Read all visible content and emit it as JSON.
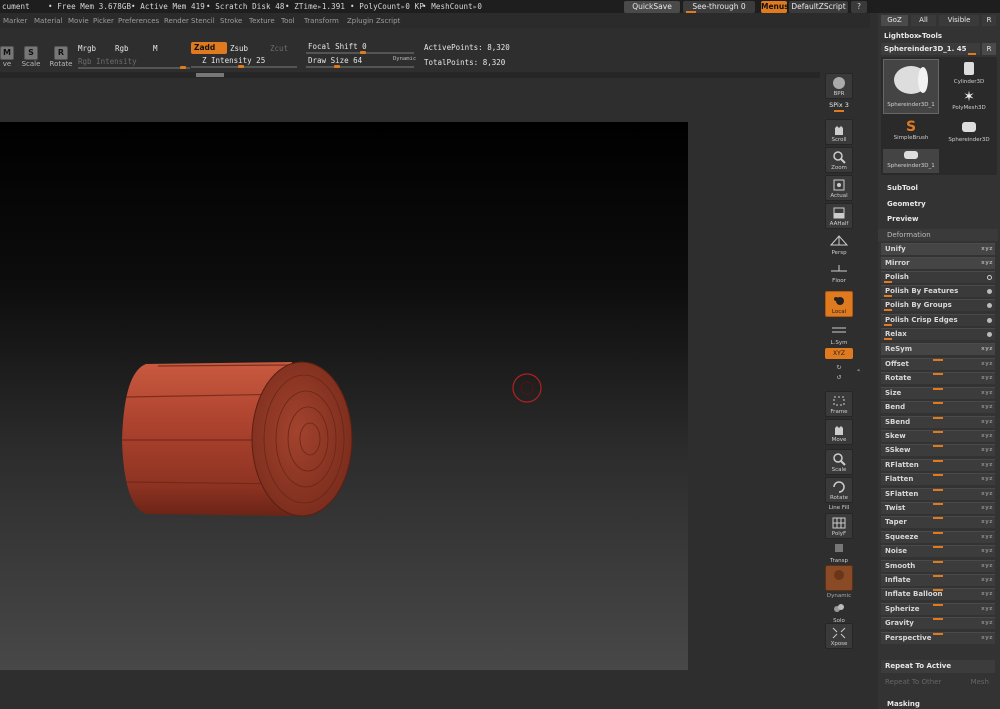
{
  "status": {
    "doc": "cument",
    "free_mem": "• Free Mem 3.678GB",
    "active_mem": "• Active Mem 419",
    "scratch": "• Scratch Disk 48",
    "ztime": "• ZTime▹1.391",
    "polycount": "• PolyCount▹0 KP",
    "meshcount": "• MeshCount▹0"
  },
  "top_buttons": {
    "quicksave": "QuickSave",
    "see_through": "See-through  0",
    "menus": "Menus",
    "default_zscript": "DefaultZScript"
  },
  "menus": [
    "Marker",
    "Material",
    "Movie",
    "Picker",
    "Preferences",
    "Render",
    "Stencil",
    "Stroke",
    "Texture",
    "Tool",
    "Transform",
    "Zplugin",
    "Zscript"
  ],
  "shelf": {
    "move_label": "ve",
    "scale_label": "Scale",
    "rotate_label": "Rotate",
    "mrgb": "Mrgb",
    "rgb": "Rgb",
    "m": "M",
    "rgb_intensity": "Rgb Intensity",
    "zadd": "Zadd",
    "zsub": "Zsub",
    "zcut": "Zcut",
    "z_intensity": "Z Intensity 25",
    "focal_shift": "Focal Shift 0",
    "draw_size": "Draw Size 64",
    "dynamic": "Dynamic",
    "active_points": "ActivePoints: 8,320",
    "total_points": "TotalPoints: 8,320",
    "levels": {
      "z_intensity": 25,
      "focal_shift": 0,
      "draw_size": 64
    }
  },
  "right_shelf": [
    {
      "name": "bpr",
      "label": "BPR"
    },
    {
      "name": "spix",
      "label": "SPix 3"
    },
    {
      "name": "scroll",
      "label": "Scroll"
    },
    {
      "name": "zoom",
      "label": "Zoom"
    },
    {
      "name": "actual",
      "label": "Actual"
    },
    {
      "name": "aahalf",
      "label": "AAHalf"
    },
    {
      "name": "persp",
      "label": "Persp"
    },
    {
      "name": "dynamic",
      "label": "Dynamic"
    },
    {
      "name": "floor",
      "label": "Floor"
    },
    {
      "name": "local",
      "label": "Local"
    },
    {
      "name": "lsym",
      "label": "L.Sym"
    },
    {
      "name": "xyz",
      "label": "XYZ"
    },
    {
      "name": "frame",
      "label": "Frame"
    },
    {
      "name": "move",
      "label": "Move"
    },
    {
      "name": "scale",
      "label": "Scale"
    },
    {
      "name": "rotate",
      "label": "Rotate"
    },
    {
      "name": "linefill",
      "label": "Line Fill"
    },
    {
      "name": "polyf",
      "label": "PolyF"
    },
    {
      "name": "transp",
      "label": "Transp"
    },
    {
      "name": "ghost",
      "label": ""
    },
    {
      "name": "dynamic2",
      "label": "Dynamic"
    },
    {
      "name": "solo",
      "label": "Solo"
    },
    {
      "name": "xpose",
      "label": "Xpose"
    }
  ],
  "panel": {
    "goz": "GoZ",
    "all": "All",
    "visible": "Visible",
    "r": "R",
    "lightbox_tools": "Lightbox▸Tools",
    "current_tool": "Sphereinder3D_1. 45",
    "thumbs": [
      "Sphereinder3D_1",
      "Cylinder3D",
      "PolyMesh3D",
      "SimpleBrush",
      "Sphereinder3D",
      "Sphereinder3D_1"
    ],
    "subtool": "SubTool",
    "geometry": "Geometry",
    "preview": "Preview",
    "deformation": "Deformation",
    "deform_items": [
      {
        "label": "Unify",
        "type": "btn"
      },
      {
        "label": "Mirror",
        "type": "btn"
      },
      {
        "label": "Polish",
        "type": "ring"
      },
      {
        "label": "Polish By Features",
        "type": "dot"
      },
      {
        "label": "Polish By Groups",
        "type": "dot"
      },
      {
        "label": "Polish Crisp Edges",
        "type": "dot"
      },
      {
        "label": "Relax",
        "type": "dot"
      },
      {
        "label": "ReSym",
        "type": "btn"
      },
      {
        "label": "Offset",
        "type": "slider"
      },
      {
        "label": "Rotate",
        "type": "slider"
      },
      {
        "label": "Size",
        "type": "slider"
      },
      {
        "label": "Bend",
        "type": "slider"
      },
      {
        "label": "SBend",
        "type": "slider"
      },
      {
        "label": "Skew",
        "type": "slider"
      },
      {
        "label": "SSkew",
        "type": "slider"
      },
      {
        "label": "RFlatten",
        "type": "slider"
      },
      {
        "label": "Flatten",
        "type": "slider"
      },
      {
        "label": "SFlatten",
        "type": "slider"
      },
      {
        "label": "Twist",
        "type": "slider"
      },
      {
        "label": "Taper",
        "type": "slider"
      },
      {
        "label": "Squeeze",
        "type": "slider"
      },
      {
        "label": "Noise",
        "type": "slider"
      },
      {
        "label": "Smooth",
        "type": "slider"
      },
      {
        "label": "Inflate",
        "type": "slider"
      },
      {
        "label": "Inflate Balloon",
        "type": "slider"
      },
      {
        "label": "Spherize",
        "type": "slider"
      },
      {
        "label": "Gravity",
        "type": "slider"
      },
      {
        "label": "Perspective",
        "type": "slider"
      }
    ],
    "repeat_to_active": "Repeat To Active",
    "repeat_to_other": "Repeat To Other",
    "mesh": "Mesh",
    "masking": "Masking"
  },
  "colors": {
    "accent": "#e07a1f",
    "mesh": "#a8432e"
  }
}
